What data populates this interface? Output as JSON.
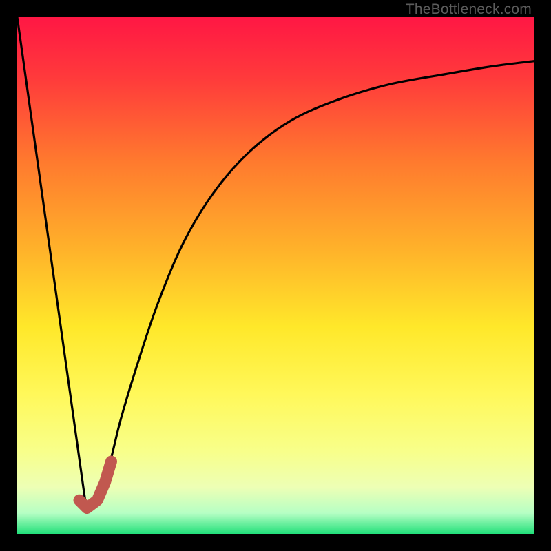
{
  "watermark": "TheBottleneck.com",
  "colors": {
    "black": "#000000",
    "curve": "#000000",
    "marker": "#c1584f"
  },
  "chart_data": {
    "type": "line",
    "title": "",
    "xlabel": "",
    "ylabel": "",
    "xlim": [
      0,
      100
    ],
    "ylim": [
      0,
      100
    ],
    "gradient_stops": [
      {
        "offset": 0,
        "color": "#ff1744"
      },
      {
        "offset": 12,
        "color": "#ff3b3b"
      },
      {
        "offset": 28,
        "color": "#ff7a2e"
      },
      {
        "offset": 45,
        "color": "#ffb22a"
      },
      {
        "offset": 60,
        "color": "#ffe82a"
      },
      {
        "offset": 73,
        "color": "#fff85a"
      },
      {
        "offset": 84,
        "color": "#f8ff8a"
      },
      {
        "offset": 91,
        "color": "#edffb5"
      },
      {
        "offset": 96,
        "color": "#b6ffc4"
      },
      {
        "offset": 100,
        "color": "#22e07a"
      }
    ],
    "series": [
      {
        "name": "left-branch",
        "x": [
          0,
          13.5
        ],
        "y": [
          100,
          4
        ]
      },
      {
        "name": "right-branch",
        "x": [
          13.5,
          16,
          18,
          20,
          23,
          27,
          32,
          38,
          45,
          53,
          62,
          72,
          83,
          92,
          100
        ],
        "y": [
          4,
          8,
          14,
          22,
          32,
          44,
          56,
          66,
          74,
          80,
          84,
          87,
          89,
          90.5,
          91.5
        ]
      }
    ],
    "marker": {
      "name": "optimal-region",
      "points": [
        {
          "x": 12.0,
          "y": 6.5
        },
        {
          "x": 13.5,
          "y": 5.0
        },
        {
          "x": 15.5,
          "y": 6.5
        },
        {
          "x": 17.0,
          "y": 10.0
        },
        {
          "x": 18.2,
          "y": 14.0
        }
      ]
    }
  }
}
